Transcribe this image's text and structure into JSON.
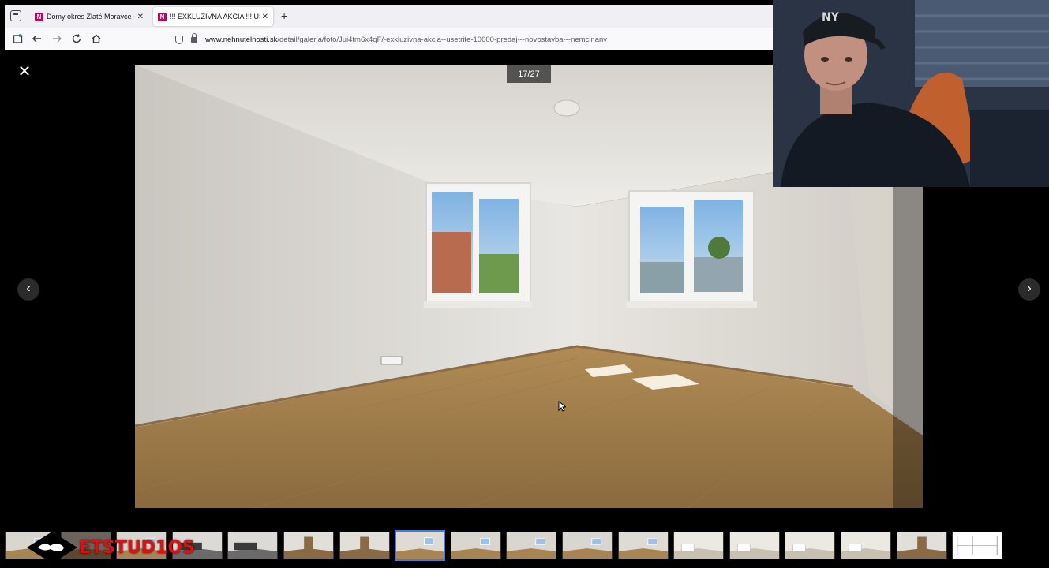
{
  "browser": {
    "tabs": [
      {
        "favicon": "N",
        "title": "Domy okres Zlaté Moravce - po",
        "active": false
      },
      {
        "favicon": "N",
        "title": "!!! EXKLUZÍVNA AKCIA !!! UŠETR",
        "active": true
      }
    ],
    "new_tab_symbol": "+",
    "url_host": "www.nehnutelnosti.sk",
    "url_path": "/detail/galeria/foto/Jui4tm6x4qF/-exkluzivna-akcia--usetrite-10000-predaj---novostavba---nemcinany"
  },
  "gallery": {
    "counter": "17/27",
    "current_index": 17,
    "total": 27,
    "close_symbol": "✕",
    "prev_symbol": "‹",
    "next_symbol": "›"
  },
  "thumbnails": {
    "count": 18,
    "active_index": 7,
    "scenes": [
      "room",
      "room-dark",
      "room",
      "kitchen",
      "kitchen",
      "door",
      "door",
      "window",
      "room",
      "room",
      "room",
      "window",
      "bath",
      "bath",
      "bath",
      "bath",
      "door",
      "plan"
    ]
  },
  "watermark": {
    "text": "ETSTUD1OS",
    "color": "#e01010"
  },
  "icons": {
    "tab_list": "tab-list-icon",
    "back": "back-arrow-icon",
    "forward": "forward-arrow-icon",
    "reload": "reload-icon",
    "home": "home-icon",
    "shield": "shield-icon",
    "lock": "lock-icon"
  }
}
